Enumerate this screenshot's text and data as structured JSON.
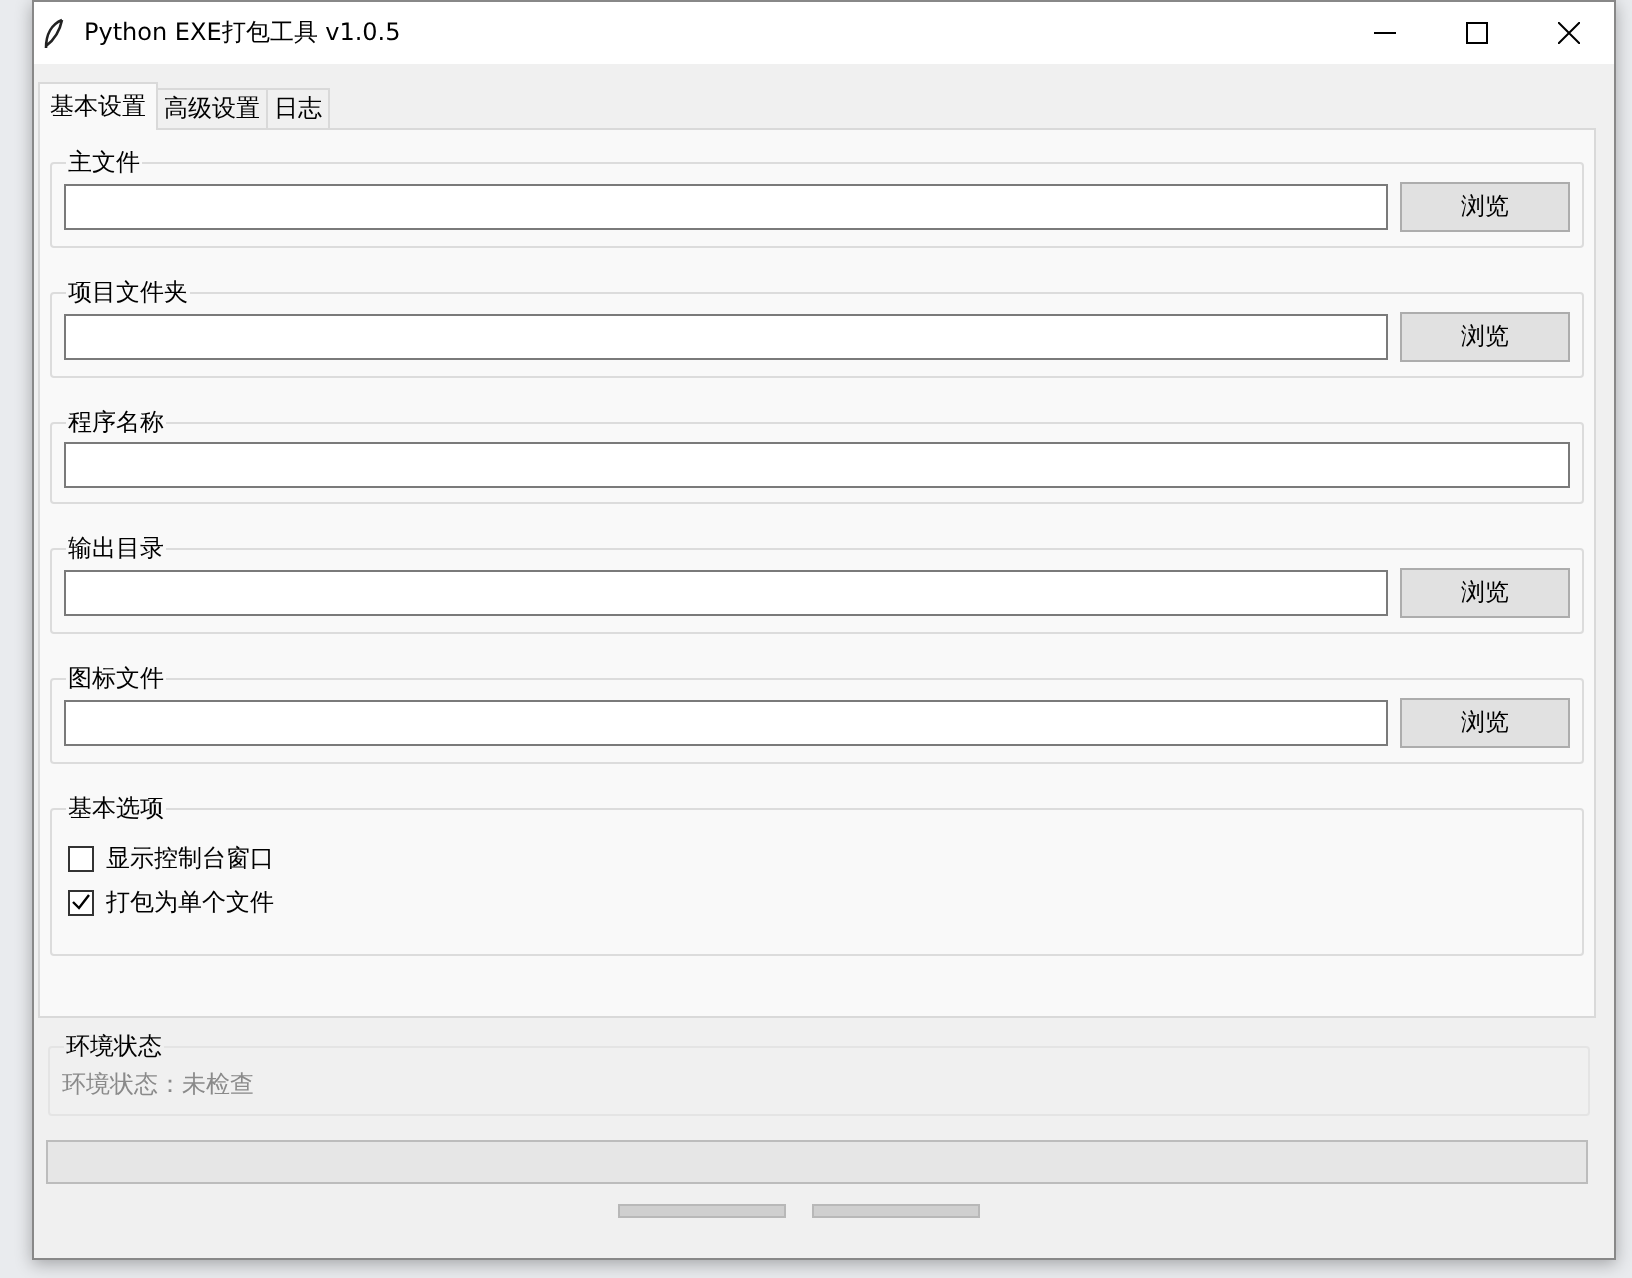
{
  "window": {
    "title": "Python EXE打包工具 v1.0.5"
  },
  "tabs": [
    {
      "label": "基本设置",
      "selected": true
    },
    {
      "label": "高级设置",
      "selected": false
    },
    {
      "label": "日志",
      "selected": false
    }
  ],
  "fields": [
    {
      "label": "主文件",
      "button": "浏览"
    },
    {
      "label": "项目文件夹",
      "button": "浏览"
    },
    {
      "label": "程序名称"
    },
    {
      "label": "输出目录",
      "button": "浏览"
    },
    {
      "label": "图标文件",
      "button": "浏览"
    }
  ],
  "options": {
    "title": "基本选项",
    "items": [
      {
        "label": "显示控制台窗口",
        "checked": false
      },
      {
        "label": "打包为单个文件",
        "checked": true
      }
    ]
  },
  "environment": {
    "title": "环境状态",
    "status": "环境状态：未检查"
  },
  "progress": {
    "level": 0
  }
}
